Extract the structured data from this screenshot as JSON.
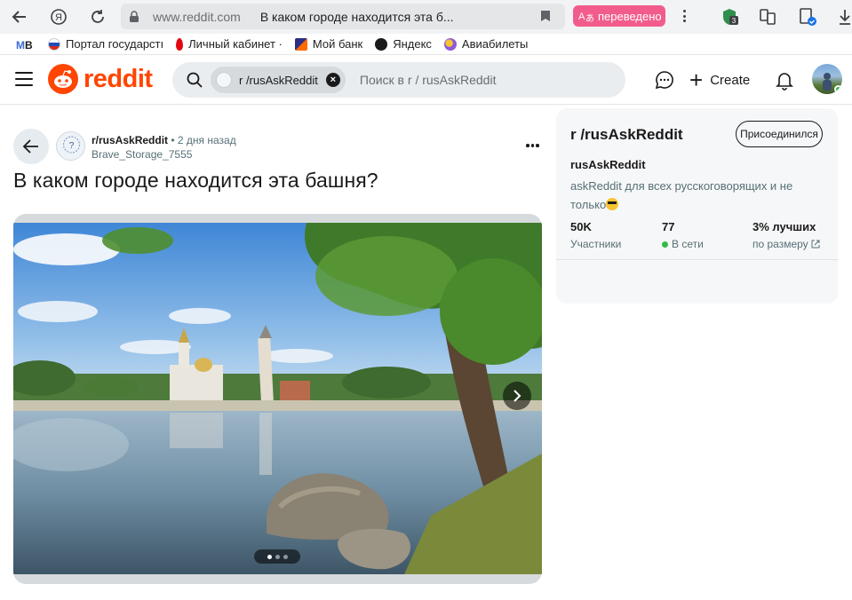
{
  "browser": {
    "address_url": "www.reddit.com",
    "tab_title": "В каком городе находится эта б...",
    "translate_label": "переведено",
    "bookmarks": [
      {
        "label": "Портал государстı",
        "icon": "flag-ru-icon"
      },
      {
        "label": "Личный кабинет ·",
        "icon": "bank-red-icon"
      },
      {
        "label": "Мой банк",
        "icon": "bank-blue-icon"
      },
      {
        "label": "Яндекс",
        "icon": "yandex-icon"
      },
      {
        "label": "Авиабилеты",
        "icon": "travel-icon"
      }
    ],
    "ext_badge": "3"
  },
  "header": {
    "logo_text": "reddit",
    "search_chip": "r /rusAskReddit",
    "search_placeholder": "Поиск в r / rusAskReddit",
    "create_label": "Create"
  },
  "post": {
    "subreddit": "r/rusAskReddit",
    "time": "• 2 дня назад",
    "author": "Brave_Storage_7555",
    "title": "В каком городе находится эта башня?",
    "gallery_index": 1,
    "gallery_count": 3
  },
  "sidebar": {
    "title": "r /rusAskReddit",
    "join_label": "Присоединился",
    "name": "rusAskReddit",
    "description": "askReddit для всех русскоговорящих и не только",
    "stats": [
      {
        "value": "50K",
        "label": "Участники"
      },
      {
        "value": "77",
        "label": "В сети"
      },
      {
        "value": "3% лучших",
        "label": "по размеру"
      }
    ]
  },
  "colors": {
    "brand": "#ff4500",
    "online": "#2dbd45",
    "translate_pill": "#f25c8c"
  }
}
